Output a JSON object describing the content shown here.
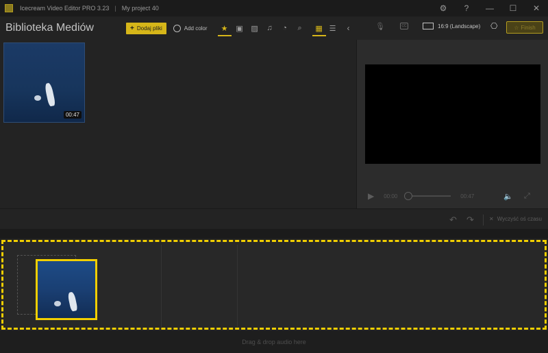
{
  "window": {
    "app_title": "Icecream Video Editor PRO 3.23",
    "separator": "|",
    "project_name": "My project 40"
  },
  "toolbar": {
    "library_title": "Biblioteka Mediów",
    "add_files_label": "Dodaj pliki",
    "add_color_label": "Add color",
    "aspect_label": "16:9 (Landscape)",
    "finish_label": "Finish"
  },
  "media": {
    "items": [
      {
        "duration": "00:47"
      }
    ]
  },
  "player": {
    "current_time": "00:00",
    "total_time": "00:47"
  },
  "edit": {
    "clear_all_label": "Wyczyść oś czasu"
  },
  "timeline": {
    "audio_drop_label": "Drag & drop audio here"
  },
  "colors": {
    "accent": "#f2cf00",
    "background": "#232323"
  }
}
